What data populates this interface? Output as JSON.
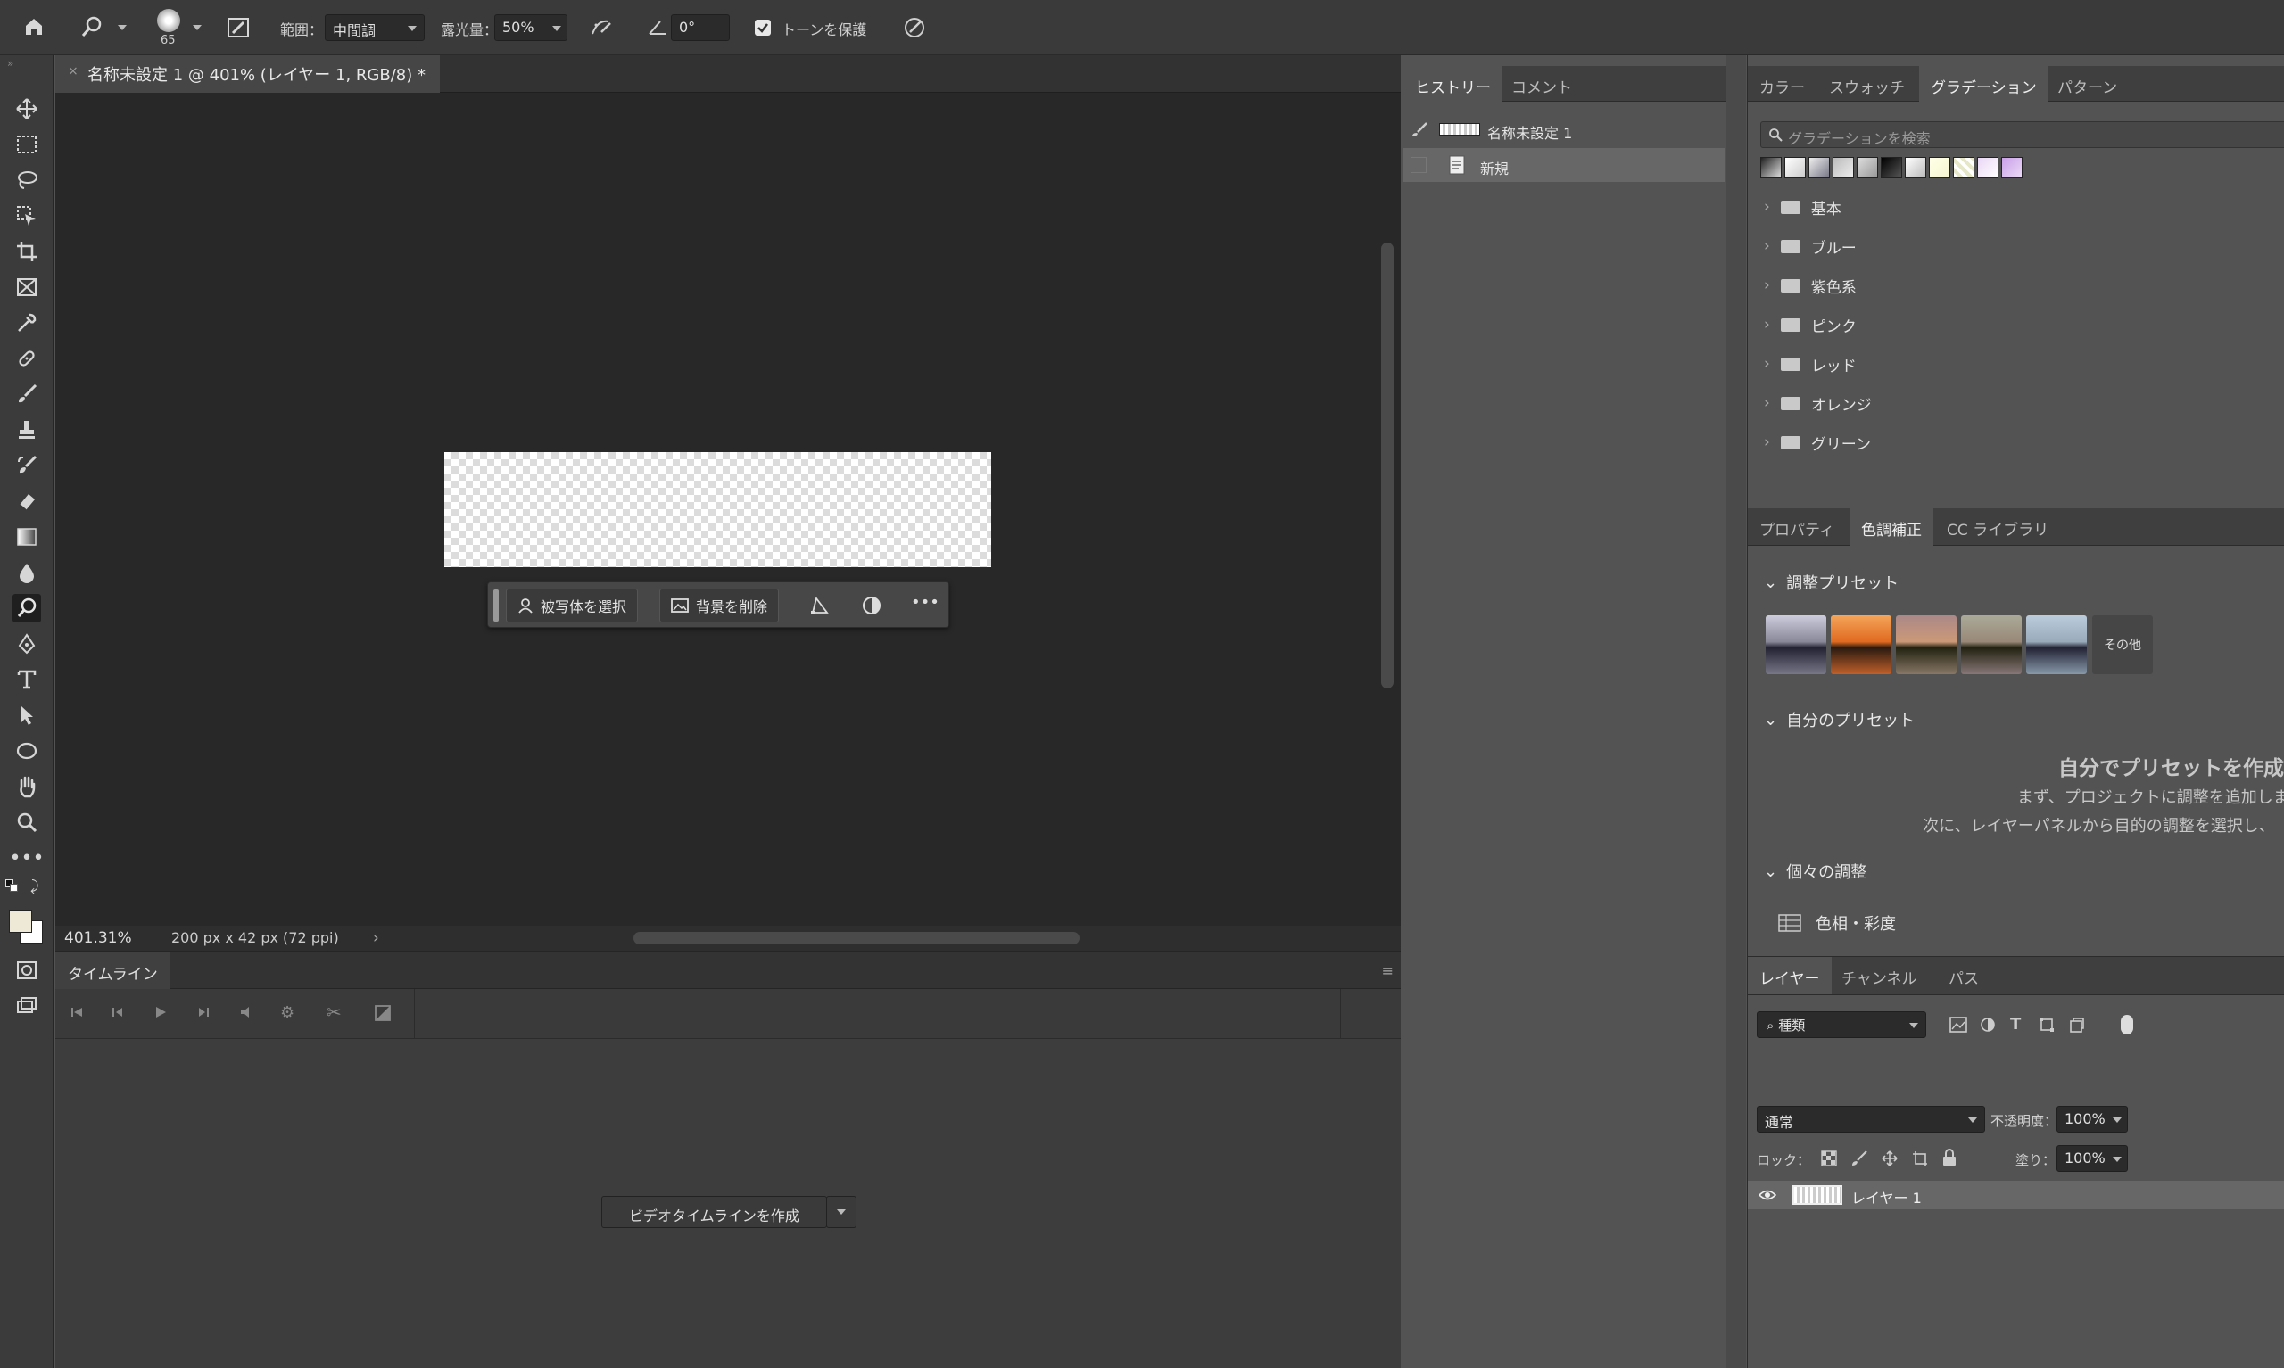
{
  "options_bar": {
    "brush_size": "65",
    "range_label": "範囲：",
    "range_value": "中間調",
    "exposure_label": "露光量：",
    "exposure_value": "50%",
    "angle_value": "0°",
    "protect_tones_label": "トーンを保護",
    "protect_tones_checked": true
  },
  "document": {
    "tab_title": "名称未設定 1 @ 401% (レイヤー 1, RGB/8) *",
    "zoom": "401.31%",
    "dimensions": "200 px x 42 px (72 ppi)"
  },
  "context_bar": {
    "select_subject": "被写体を選択",
    "remove_background": "背景を削除"
  },
  "timeline": {
    "tab_label": "タイムライン",
    "create_button": "ビデオタイムラインを作成"
  },
  "history_panel": {
    "tabs": [
      "ヒストリー",
      "コメント"
    ],
    "snapshot": "名称未設定 1",
    "items": [
      "新規"
    ]
  },
  "gradient_panel": {
    "tabs": [
      "カラー",
      "スウォッチ",
      "グラデーション",
      "パターン"
    ],
    "active_tab": "グラデーション",
    "search_placeholder": "グラデーションを検索",
    "folders": [
      "基本",
      "ブルー",
      "紫色系",
      "ピンク",
      "レッド",
      "オレンジ",
      "グリーン"
    ]
  },
  "adjustments_panel": {
    "tabs": [
      "プロパティ",
      "色調補正",
      "CC ライブラリ"
    ],
    "active_tab": "色調補正",
    "presets_title": "調整プリセット",
    "more_label": "その他",
    "my_presets_title": "自分のプリセット",
    "my_presets_heading": "自分でプリセットを作成",
    "my_presets_line1": "まず、プロジェクトに調整を追加しま",
    "my_presets_line2": "次に、レイヤーパネルから目的の調整を選択し、",
    "individual_title": "個々の調整",
    "hue_saturation": "色相・彩度"
  },
  "layers_panel": {
    "tabs": [
      "レイヤー",
      "チャンネル",
      "パス"
    ],
    "filter_value": "種類",
    "blend_mode": "通常",
    "opacity_label": "不透明度：",
    "opacity_value": "100%",
    "lock_label": "ロック：",
    "fill_label": "塗り：",
    "fill_value": "100%",
    "layer_name": "レイヤー 1"
  },
  "colors": {
    "foreground": "#ede9d6",
    "background": "#ffffff"
  }
}
